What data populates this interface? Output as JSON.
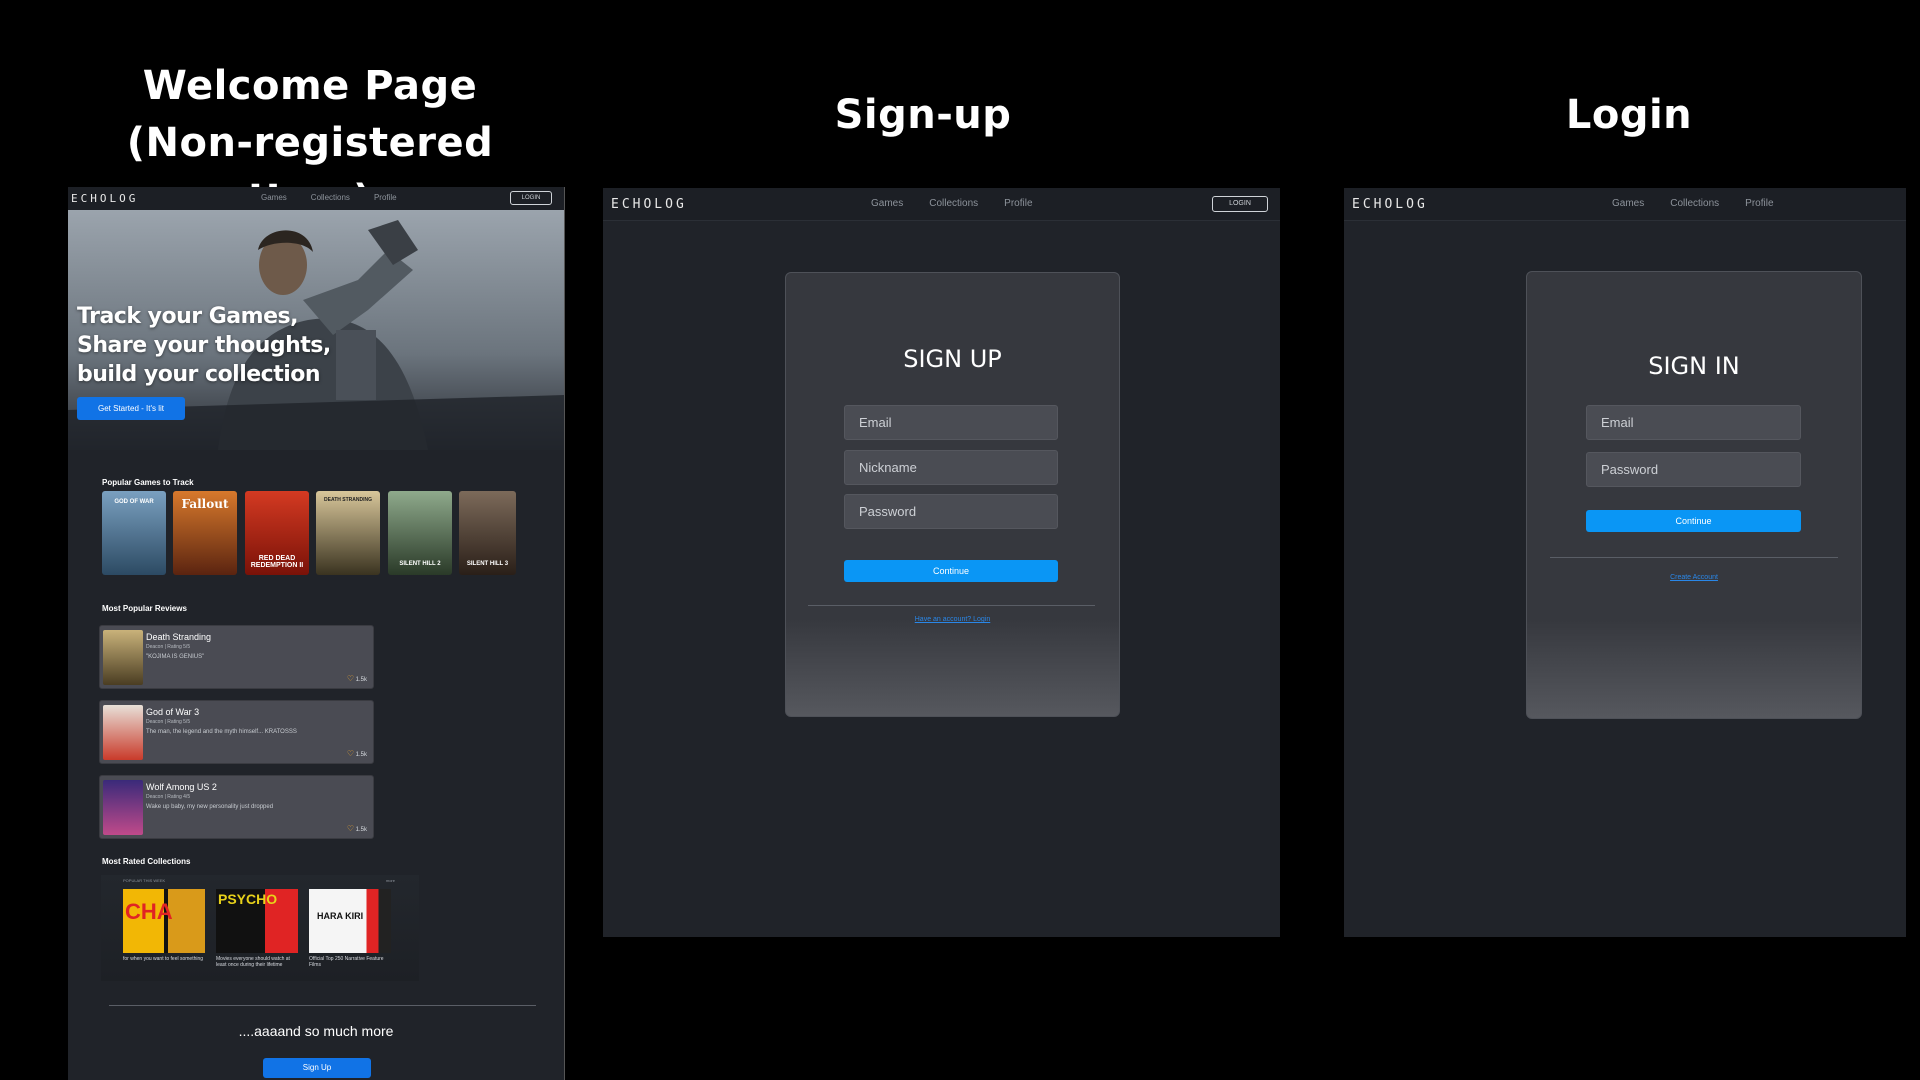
{
  "sections": {
    "welcome_title": "Welcome Page",
    "welcome_subtitle": "(Non-registered User)",
    "signup_title": "Sign-up",
    "login_title": "Login"
  },
  "nav": {
    "logo": "ECHOLOG",
    "links": [
      "Games",
      "Collections",
      "Profile"
    ],
    "login_label": "LOGIN"
  },
  "welcome": {
    "hero_line1": "Track your Games,",
    "hero_line2": "Share your thoughts,",
    "hero_line3": "build your collection",
    "cta_label": "Get Started - It's lit",
    "popular_games_heading": "Popular Games to Track",
    "popular_games": [
      {
        "name": "GOD OF WAR",
        "color_top": "#7aa0c0",
        "color_bottom": "#2c4a63"
      },
      {
        "name": "Fallout",
        "color_top": "#d7792c",
        "color_bottom": "#5b2410"
      },
      {
        "name": "RED DEAD REDEMPTION II",
        "color_top": "#d43a22",
        "color_bottom": "#7a1208"
      },
      {
        "name": "DEATH STRANDING",
        "color_top": "#d8c69a",
        "color_bottom": "#3a3320"
      },
      {
        "name": "SILENT HILL 2",
        "color_top": "#8faa8c",
        "color_bottom": "#2a3a28"
      },
      {
        "name": "SILENT HILL 3",
        "color_top": "#7c6a5a",
        "color_bottom": "#2a1f18"
      }
    ],
    "reviews_heading": "Most Popular Reviews",
    "reviews": [
      {
        "title": "Death Stranding",
        "meta": "Deacon | Rating 5/5",
        "text": "\"KOJIMA IS GENIUS\"",
        "likes": "1.5k",
        "thumb": "#9b8a5a"
      },
      {
        "title": "God of War 3",
        "meta": "Deacon | Rating 5/5",
        "text": "The man, the legend and the myth himself... KRATOSSS",
        "likes": "1.5k",
        "thumb": "#c93a2a"
      },
      {
        "title": "Wolf Among US 2",
        "meta": "Deacon | Rating 4/5",
        "text": "Wake up baby, my new personality just dropped",
        "likes": "1.5k",
        "thumb": "#5a3aa0"
      }
    ],
    "collections_heading": "Most Rated Collections",
    "collections_label": "POPULAR THIS WEEK",
    "collections_more": "more",
    "collections": [
      {
        "title": "for when you want to feel something",
        "cover_text": "CHA",
        "cover_color": "#f2b705"
      },
      {
        "title": "Movies everyone should watch at least once during their lifetime",
        "cover_text": "PSYCHO",
        "cover_color": "#e8d21a"
      },
      {
        "title": "Official Top 250 Narrative Feature Films",
        "cover_text": "HARA KIRI",
        "cover_color": "#e02424"
      }
    ],
    "more_text": "....aaaand so much more",
    "signup_button": "Sign Up"
  },
  "signup": {
    "title": "SIGN UP",
    "email_placeholder": "Email",
    "nickname_placeholder": "Nickname",
    "password_placeholder": "Password",
    "continue_label": "Continue",
    "login_link": "Have an account? Login"
  },
  "login": {
    "title": "SIGN IN",
    "email_placeholder": "Email",
    "password_placeholder": "Password",
    "continue_label": "Continue",
    "create_link": "Create Account"
  },
  "colors": {
    "screen_bg": "#202329",
    "primary_button": "#1173e6",
    "continue_button": "#0a96f5"
  }
}
